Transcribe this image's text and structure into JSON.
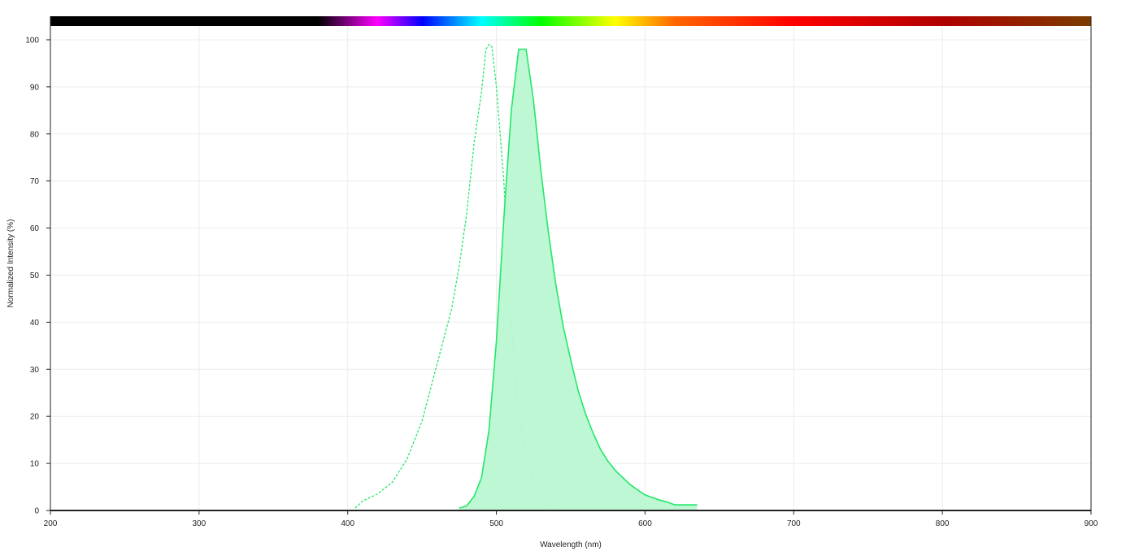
{
  "chart_data": {
    "type": "area",
    "xlabel": "Wavelength (nm)",
    "ylabel": "Normalized Intensity (%)",
    "xlim": [
      200,
      900
    ],
    "ylim": [
      0,
      105
    ],
    "x_ticks": [
      200,
      300,
      400,
      500,
      600,
      700,
      800,
      900
    ],
    "y_ticks": [
      0,
      10,
      20,
      30,
      40,
      50,
      60,
      70,
      80,
      90,
      100
    ],
    "grid": true,
    "legend": "none",
    "spectrum_bar": {
      "colors": [
        {
          "nm": 200,
          "color": "#000000"
        },
        {
          "nm": 380,
          "color": "#000000"
        },
        {
          "nm": 420,
          "color": "#ff00ff"
        },
        {
          "nm": 450,
          "color": "#0000ff"
        },
        {
          "nm": 490,
          "color": "#00ffff"
        },
        {
          "nm": 530,
          "color": "#00ff00"
        },
        {
          "nm": 580,
          "color": "#ffff00"
        },
        {
          "nm": 620,
          "color": "#ff6600"
        },
        {
          "nm": 700,
          "color": "#ff0000"
        },
        {
          "nm": 800,
          "color": "#b00000"
        },
        {
          "nm": 900,
          "color": "#7a3d00"
        }
      ]
    },
    "series": [
      {
        "style": "dashed",
        "color": "#22e86a",
        "x": [
          405,
          410,
          420,
          430,
          440,
          450,
          455,
          460,
          465,
          470,
          475,
          480,
          485,
          490,
          493,
          495,
          497,
          500,
          505,
          510,
          515,
          520,
          525,
          530,
          535,
          540,
          545
        ],
        "y": [
          0.5,
          2,
          3.5,
          6,
          11,
          19,
          25,
          31,
          37,
          43,
          52,
          63,
          78,
          89,
          98,
          99,
          98.5,
          90,
          70,
          40,
          20,
          12,
          6,
          2.5,
          1,
          0.4,
          0.1
        ]
      },
      {
        "style": "solid",
        "color": "#22e86a",
        "fill": "#baf7d2",
        "x": [
          475,
          480,
          485,
          490,
          495,
          500,
          505,
          510,
          515,
          520,
          525,
          530,
          535,
          540,
          545,
          550,
          555,
          560,
          565,
          570,
          575,
          580,
          590,
          600,
          610,
          615,
          620,
          625,
          630,
          635
        ],
        "y": [
          0.5,
          1,
          3,
          7,
          17,
          36,
          62,
          85,
          98,
          98,
          87,
          72,
          59,
          48,
          39,
          32,
          25.5,
          20.5,
          16.5,
          13,
          10.5,
          8.5,
          5.5,
          3.3,
          2.2,
          1.8,
          1.2,
          1.2,
          1.2,
          1.2
        ]
      }
    ]
  }
}
